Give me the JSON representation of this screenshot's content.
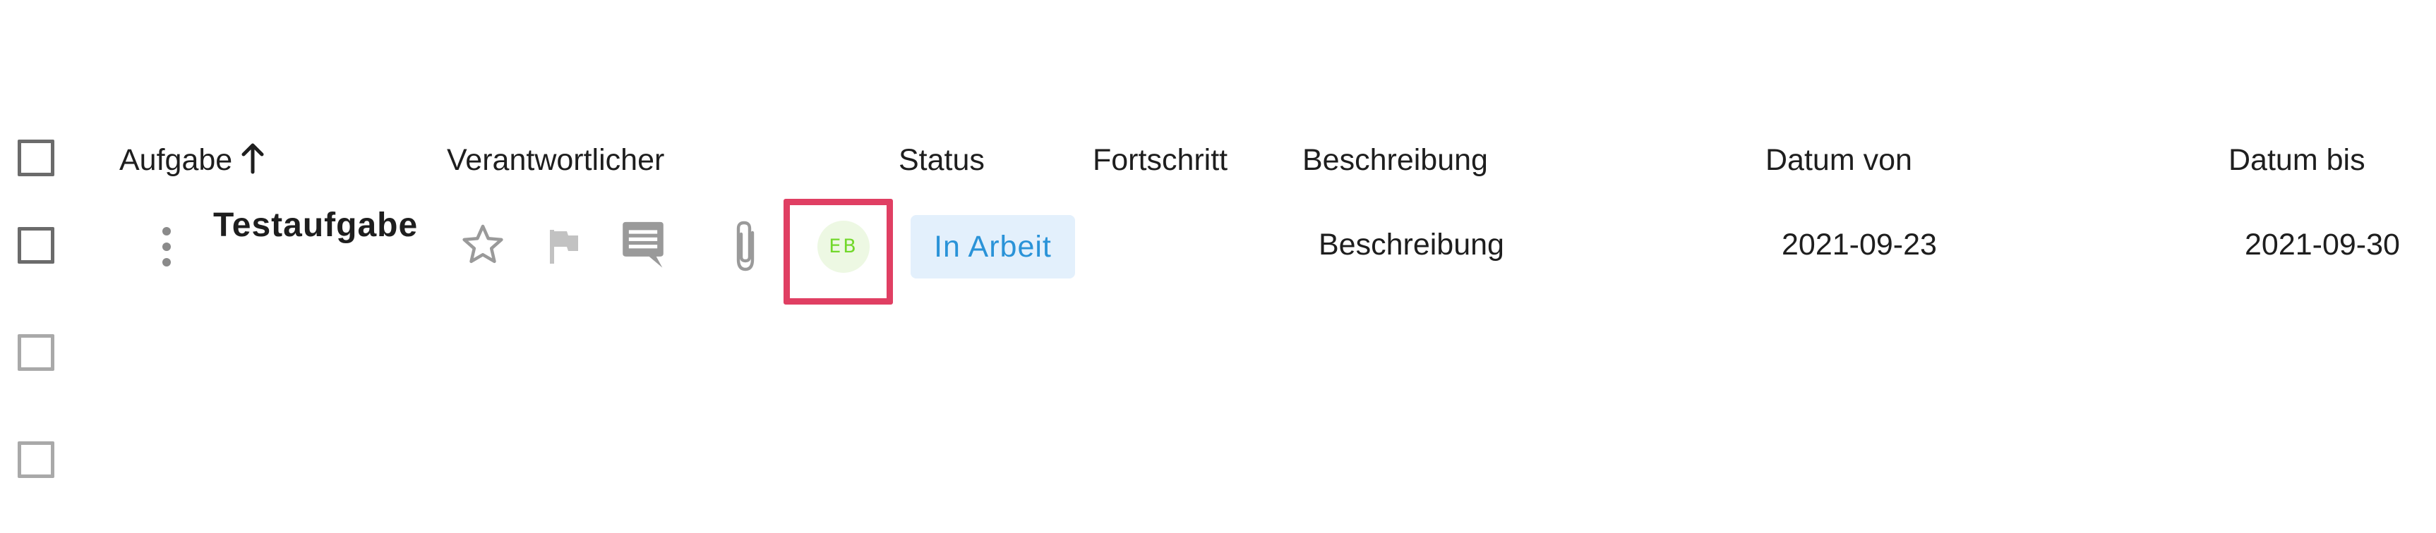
{
  "table": {
    "headers": {
      "task": "Aufgabe",
      "owner": "Verantwortlicher",
      "status": "Status",
      "progress": "Fortschritt",
      "description": "Beschreibung",
      "date_from": "Datum von",
      "date_to": "Datum bis"
    },
    "sort": {
      "column": "Aufgabe",
      "direction": "ascending",
      "icon": "arrow-up-icon"
    },
    "rows": [
      {
        "title": "Testaufgabe",
        "actions": [
          "more-vert-icon",
          "star-icon",
          "flag-icon",
          "comment-icon",
          "paperclip-icon"
        ],
        "owner_initials": "EB",
        "status": "In Arbeit",
        "progress": "",
        "description": "Beschreibung",
        "date_from": "2021-09-23",
        "date_to": "2021-09-30"
      }
    ],
    "empty_rows": 2
  },
  "colors": {
    "highlight": "#e03f63",
    "status_chip_bg": "#e3f0fc",
    "status_chip_text": "#2a93d8",
    "avatar_bg": "#edf8e3",
    "avatar_text": "#72d82b",
    "icon_gray": "#9a9a9a"
  }
}
